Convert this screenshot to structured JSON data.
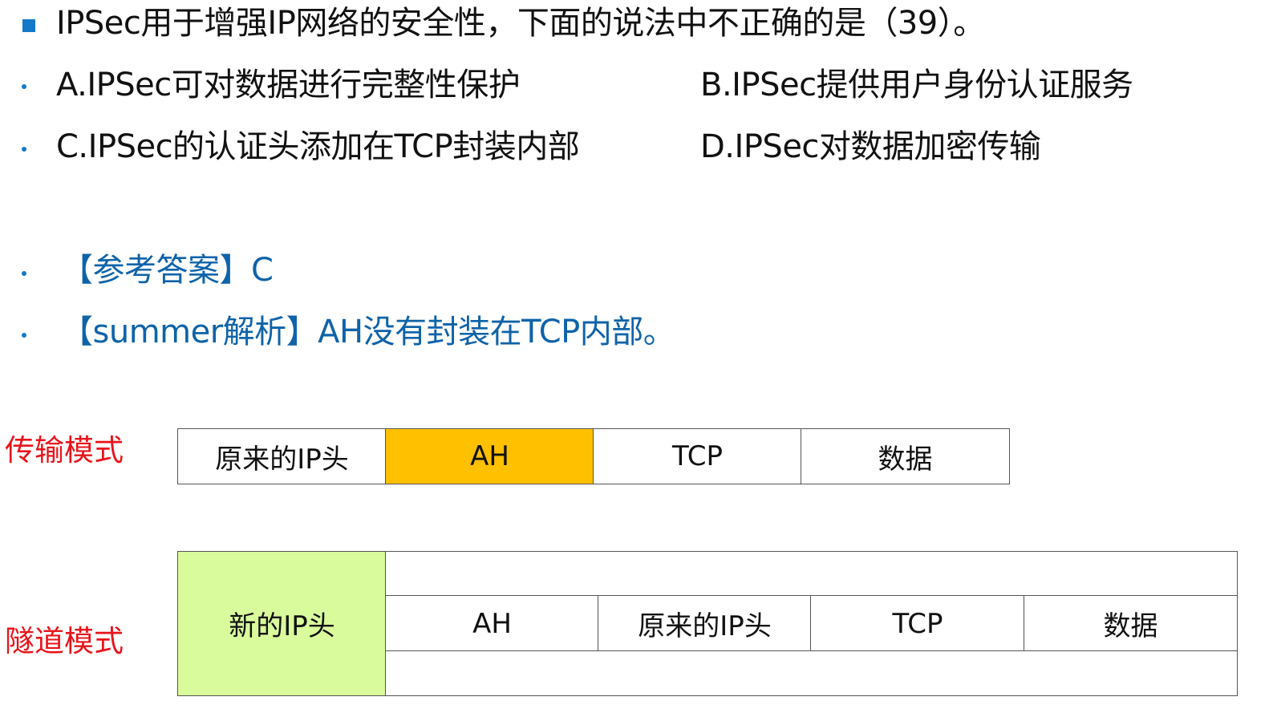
{
  "question": {
    "stem": "IPSec用于增强IP网络的安全性，下面的说法中不正确的是（39）。",
    "options": {
      "A": "A.IPSec可对数据进行完整性保护",
      "B": "B.IPSec提供用户身份认证服务",
      "C": "C.IPSec的认证头添加在TCP封装内部",
      "D": "D.IPSec对数据加密传输"
    }
  },
  "answer": {
    "reference": "【参考答案】C",
    "analysis": "【summer解析】AH没有封装在TCP内部。"
  },
  "colors": {
    "bullet": "#1479c8",
    "answer_text": "#0e63a8",
    "mode_label": "#e8141b",
    "ah_fill": "#ffc000",
    "new_ip_fill": "#d9fb9c"
  },
  "transport_mode": {
    "label": "传输模式",
    "cells": [
      "原来的IP头",
      "AH",
      "TCP",
      "数据"
    ]
  },
  "tunnel_mode": {
    "label": "隧道模式",
    "new_ip_header": "新的IP头",
    "cells": [
      "AH",
      "原来的IP头",
      "TCP",
      "数据"
    ]
  }
}
